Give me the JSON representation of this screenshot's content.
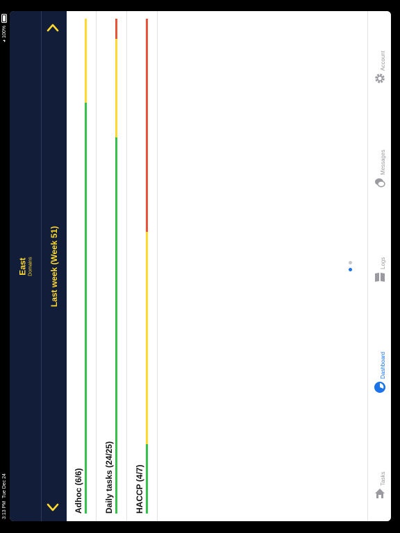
{
  "status_bar": {
    "time": "3:13 PM",
    "date": "Tue Dec 24",
    "battery": "100%"
  },
  "header": {
    "title": "East",
    "subtitle": "Domains",
    "period": "Last week (Week 51)",
    "accent_color": "#ffd92e",
    "background_color": "#121d3a"
  },
  "categories": [
    {
      "label": "Adhoc (6/6)",
      "segments": [
        {
          "status": "ok",
          "color": "#35c24a",
          "fraction": 0.83
        },
        {
          "status": "warning",
          "color": "#ffd92e",
          "fraction": 0.17
        }
      ]
    },
    {
      "label": "Daily tasks (24/25)",
      "segments": [
        {
          "status": "ok",
          "color": "#35c24a",
          "fraction": 0.76
        },
        {
          "status": "warning",
          "color": "#ffd92e",
          "fraction": 0.2
        },
        {
          "status": "overdue",
          "color": "#e8533a",
          "fraction": 0.04
        }
      ]
    },
    {
      "label": "HACCP (4/7)",
      "segments": [
        {
          "status": "ok",
          "color": "#35c24a",
          "fraction": 0.14
        },
        {
          "status": "warning",
          "color": "#ffd92e",
          "fraction": 0.43
        },
        {
          "status": "overdue",
          "color": "#e8533a",
          "fraction": 0.43
        }
      ]
    }
  ],
  "pagination": {
    "pages": 2,
    "current": 2
  },
  "tabs": [
    {
      "label": "Tasks",
      "icon": "house-icon",
      "active": false
    },
    {
      "label": "Dashboard",
      "icon": "dashboard-gauge-icon",
      "active": true
    },
    {
      "label": "Logs",
      "icon": "book-icon",
      "active": false
    },
    {
      "label": "Messages",
      "icon": "chat-bubbles-icon",
      "active": false
    },
    {
      "label": "Account",
      "icon": "gear-icon",
      "active": false
    }
  ],
  "colors": {
    "active_tab": "#1a73e8",
    "inactive_tab": "#9a9aa0"
  }
}
